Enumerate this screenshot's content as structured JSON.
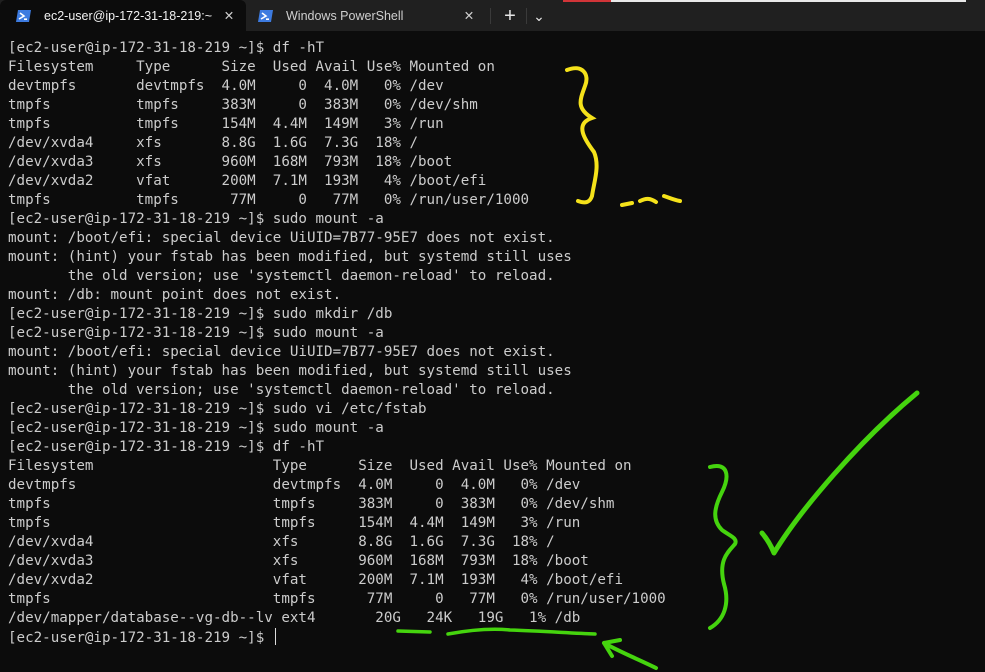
{
  "tabs": [
    {
      "label": "ec2-user@ip-172-31-18-219:~",
      "icon": "powershell-icon",
      "active": true
    },
    {
      "label": "Windows PowerShell",
      "icon": "powershell-icon",
      "active": false
    }
  ],
  "tab_buttons": {
    "close": "✕",
    "new_tab": "+",
    "dropdown": "⌄"
  },
  "terminal": {
    "lines": [
      "[ec2-user@ip-172-31-18-219 ~]$ df -hT",
      "Filesystem     Type      Size  Used Avail Use% Mounted on",
      "devtmpfs       devtmpfs  4.0M     0  4.0M   0% /dev",
      "tmpfs          tmpfs     383M     0  383M   0% /dev/shm",
      "tmpfs          tmpfs     154M  4.4M  149M   3% /run",
      "/dev/xvda4     xfs       8.8G  1.6G  7.3G  18% /",
      "/dev/xvda3     xfs       960M  168M  793M  18% /boot",
      "/dev/xvda2     vfat      200M  7.1M  193M   4% /boot/efi",
      "tmpfs          tmpfs      77M     0   77M   0% /run/user/1000",
      "[ec2-user@ip-172-31-18-219 ~]$ sudo mount -a",
      "mount: /boot/efi: special device UiUID=7B77-95E7 does not exist.",
      "mount: (hint) your fstab has been modified, but systemd still uses",
      "       the old version; use 'systemctl daemon-reload' to reload.",
      "mount: /db: mount point does not exist.",
      "[ec2-user@ip-172-31-18-219 ~]$ sudo mkdir /db",
      "[ec2-user@ip-172-31-18-219 ~]$ sudo mount -a",
      "mount: /boot/efi: special device UiUID=7B77-95E7 does not exist.",
      "mount: (hint) your fstab has been modified, but systemd still uses",
      "       the old version; use 'systemctl daemon-reload' to reload.",
      "[ec2-user@ip-172-31-18-219 ~]$ sudo vi /etc/fstab",
      "[ec2-user@ip-172-31-18-219 ~]$ sudo mount -a",
      "[ec2-user@ip-172-31-18-219 ~]$ df -hT",
      "Filesystem                     Type      Size  Used Avail Use% Mounted on",
      "devtmpfs                       devtmpfs  4.0M     0  4.0M   0% /dev",
      "tmpfs                          tmpfs     383M     0  383M   0% /dev/shm",
      "tmpfs                          tmpfs     154M  4.4M  149M   3% /run",
      "/dev/xvda4                     xfs       8.8G  1.6G  7.3G  18% /",
      "/dev/xvda3                     xfs       960M  168M  793M  18% /boot",
      "/dev/xvda2                     vfat      200M  7.1M  193M   4% /boot/efi",
      "tmpfs                          tmpfs      77M     0   77M   0% /run/user/1000",
      "/dev/mapper/database--vg-db--lv ext4       20G   24K   19G   1% /db"
    ],
    "prompt": "[ec2-user@ip-172-31-18-219 ~]$ "
  },
  "colors": {
    "terminal_bg": "#0c0c0c",
    "terminal_fg": "#cccccc",
    "annotation_yellow": "#f5e21a",
    "annotation_green": "#45d40e"
  }
}
